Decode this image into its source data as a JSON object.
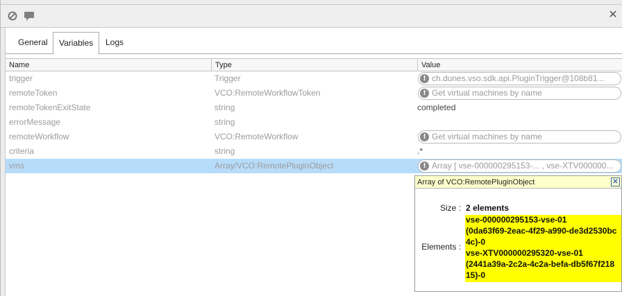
{
  "window": {
    "toolbar_icons": [
      "disable-icon",
      "comment-icon"
    ],
    "close_icon": "close-icon"
  },
  "tabs": [
    {
      "label": "General",
      "active": false
    },
    {
      "label": "Variables",
      "active": true
    },
    {
      "label": "Logs",
      "active": false
    }
  ],
  "table": {
    "columns": [
      "Name",
      "Type",
      "Value"
    ],
    "rows": [
      {
        "name": "trigger",
        "type": "Trigger",
        "value": "ch.dunes.vso.sdk.api.PluginTrigger@108b81...",
        "value_style": "pill"
      },
      {
        "name": "remoteToken",
        "type": "VCO:RemoteWorkflowToken",
        "value": "Get virtual machines by name",
        "value_style": "pill"
      },
      {
        "name": "remoteTokenExitState",
        "type": "string",
        "value": "completed",
        "value_style": "plain"
      },
      {
        "name": "errorMessage",
        "type": "string",
        "value": "",
        "value_style": "plain"
      },
      {
        "name": "remoteWorkflow",
        "type": "VCO:RemoteWorkflow",
        "value": "Get virtual machines by name",
        "value_style": "pill"
      },
      {
        "name": "criteria",
        "type": "string",
        "value": ".*",
        "value_style": "plain"
      },
      {
        "name": "vms",
        "type": "Array/VCO:RemotePluginObject",
        "value": "Array [ vse-000000295153-... , vse-XTV000000...",
        "value_style": "pill",
        "selected": true
      }
    ]
  },
  "popup": {
    "title": "Array of VCO:RemotePluginObject",
    "size_label": "Size :",
    "size_value": "2 elements",
    "elements_label": "Elements :",
    "elements_lines": [
      "vse-000000295153-vse-01",
      "(0da63f69-2eac-4f29-a990-de3d2530bc",
      "4c)-0",
      "vse-XTV000000295320-vse-01",
      "(2441a39a-2c2a-4c2a-befa-db5f67f218",
      "15)-0"
    ],
    "highlight_color": "#ffff00"
  },
  "colors": {
    "selected_row": "#b7dcfa",
    "popup_header": "#ffffcc"
  }
}
